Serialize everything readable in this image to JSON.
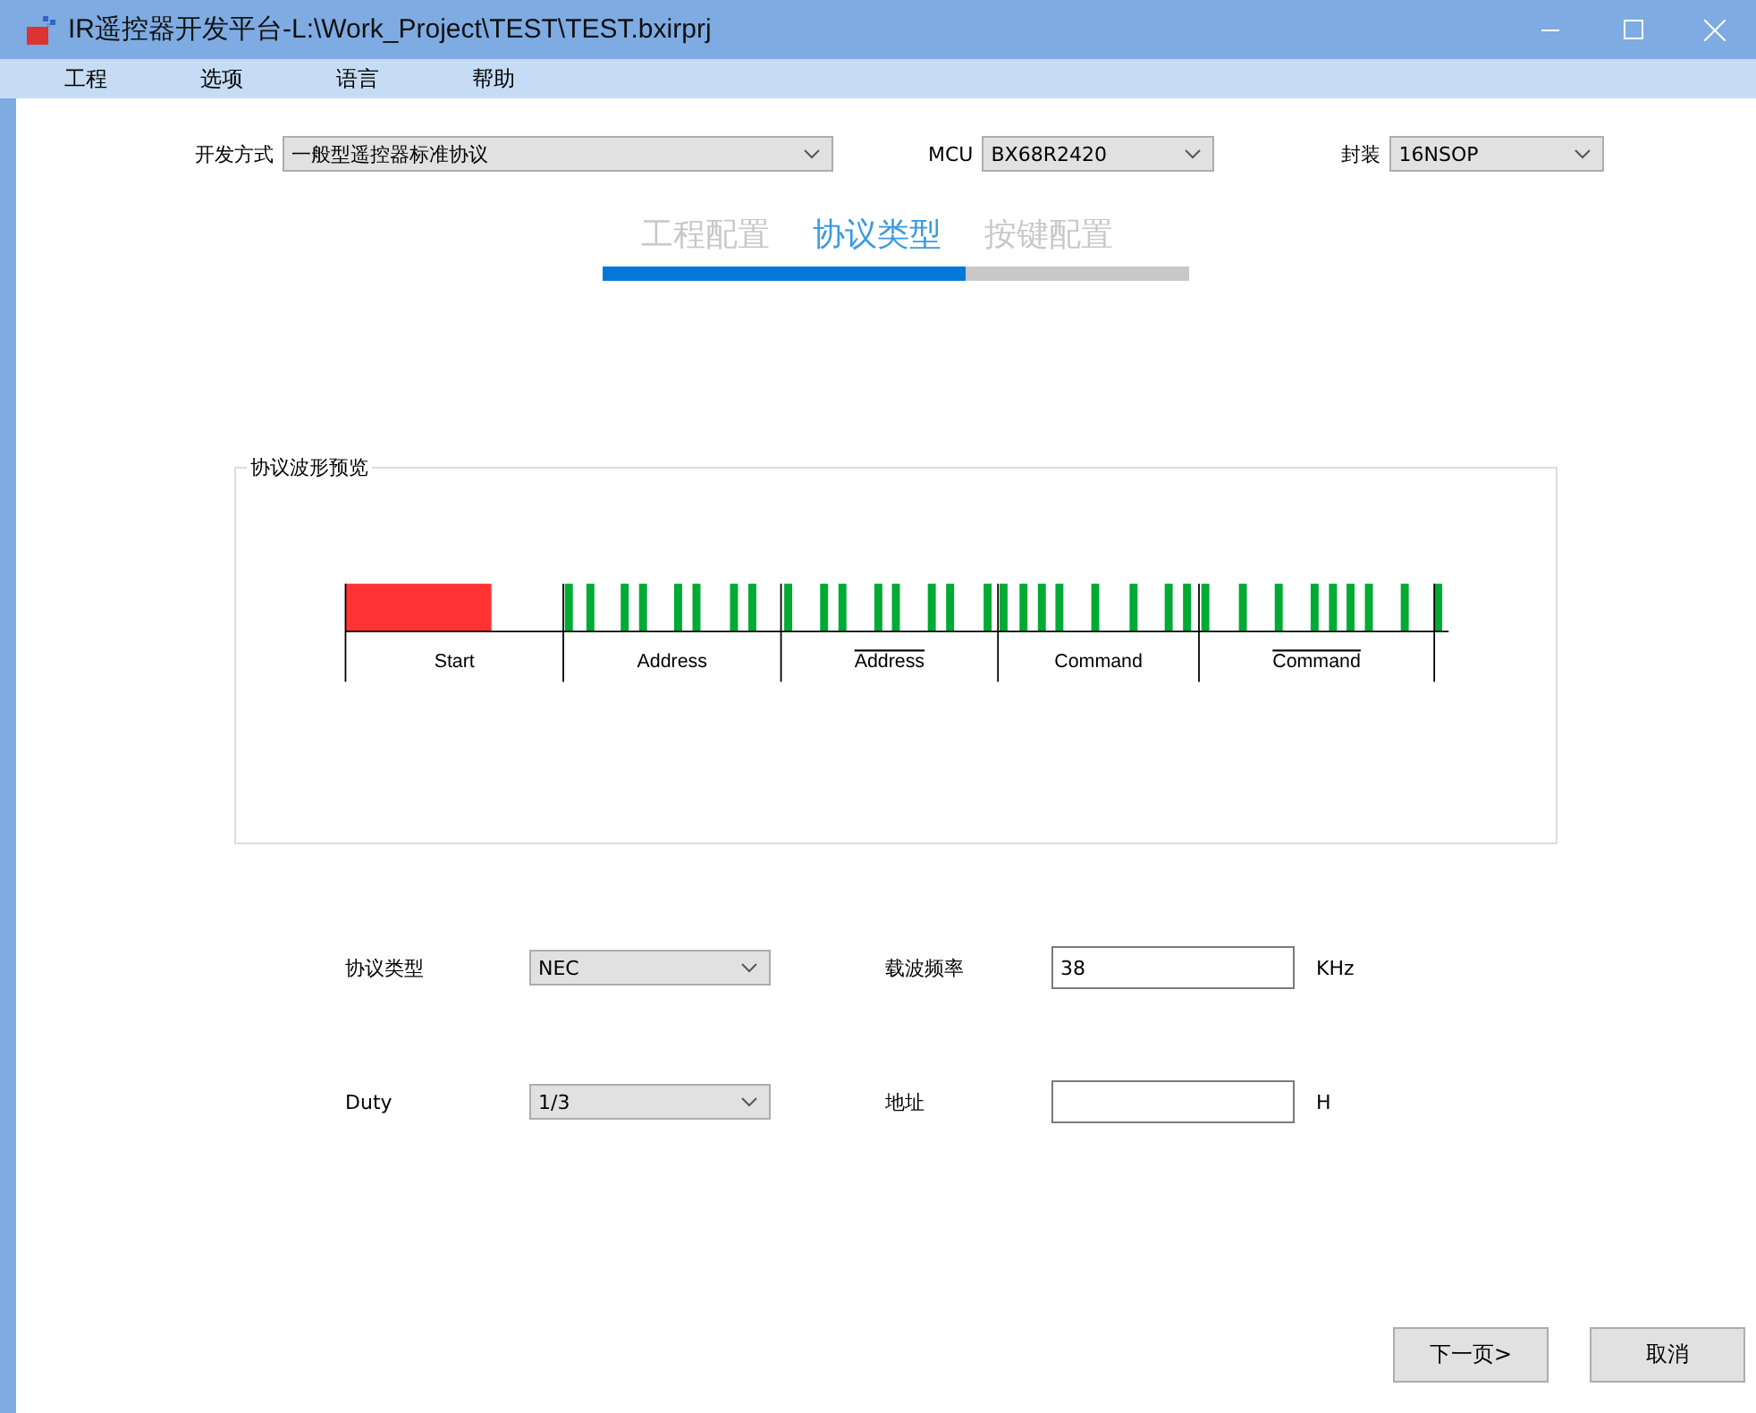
{
  "window": {
    "title": "IR遥控器开发平台-L:\\Work_Project\\TEST\\TEST.bxirprj"
  },
  "menu": [
    "工程",
    "选项",
    "语言",
    "帮助"
  ],
  "top_fields": [
    {
      "label": "开发方式",
      "value": "一般型遥控器标准协议"
    },
    {
      "label": "MCU",
      "value": "BX68R2420"
    },
    {
      "label": "封装",
      "value": "16NSOP"
    }
  ],
  "steps": [
    {
      "label": "工程配置",
      "selected": false
    },
    {
      "label": "协议类型",
      "selected": true
    },
    {
      "label": "按键配置",
      "selected": false
    }
  ],
  "progress": {
    "level": 0.62
  },
  "waveform": {
    "title": "协议波形预览",
    "segments": [
      {
        "label": "Start",
        "overlined": false
      },
      {
        "label": "Address",
        "overlined": false
      },
      {
        "label": "Address",
        "overlined": true
      },
      {
        "label": "Command",
        "overlined": false
      },
      {
        "label": "Command",
        "overlined": true
      }
    ]
  },
  "form": [
    {
      "label": "协议类型",
      "kind": "select",
      "value": "NEC"
    },
    {
      "label": "载波频率",
      "kind": "input",
      "value": "38",
      "unit": "KHz"
    },
    {
      "label": "Duty",
      "kind": "select",
      "value": "1/3"
    },
    {
      "label": "地址",
      "kind": "input",
      "unit": "H"
    }
  ],
  "buttons": [
    "下一页>",
    "取消"
  ]
}
